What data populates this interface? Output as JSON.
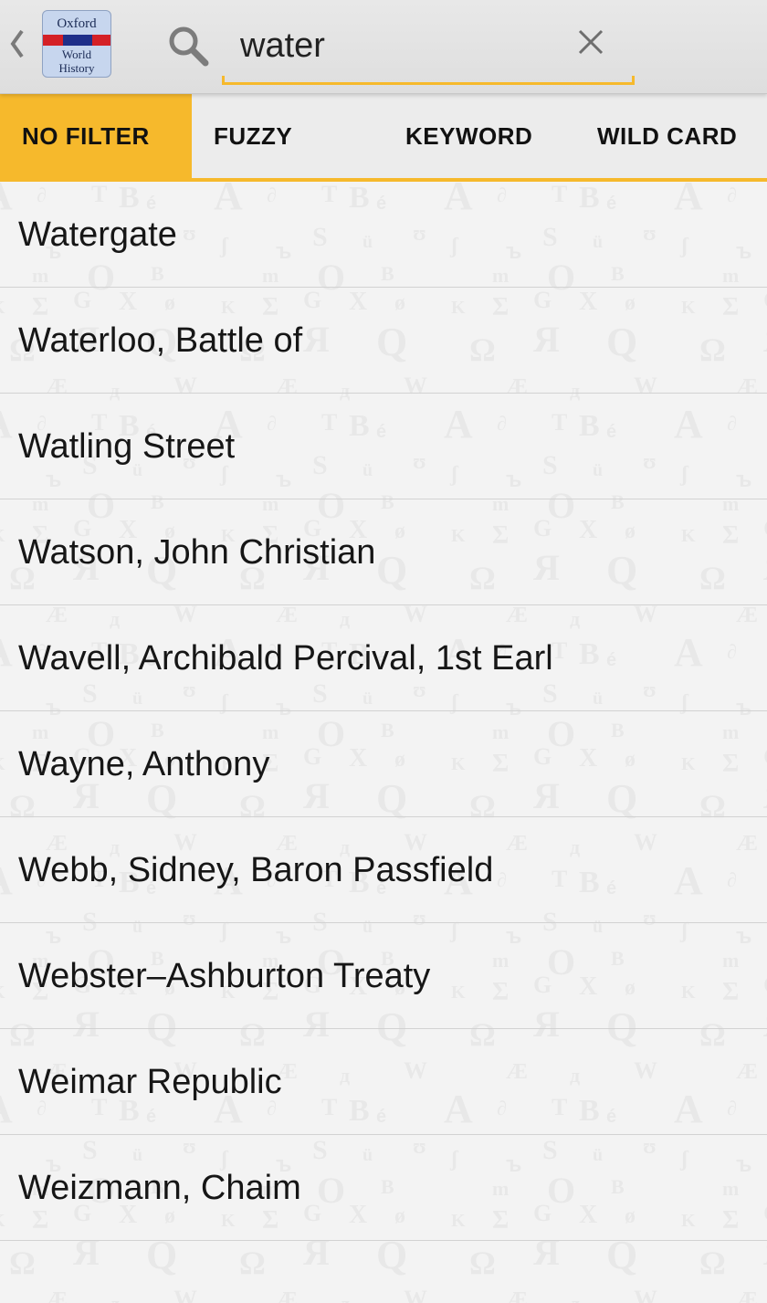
{
  "app": {
    "logo_lines": [
      "Oxford",
      "World",
      "History"
    ]
  },
  "search": {
    "value": "water",
    "placeholder": ""
  },
  "icons": {
    "back": "chevron-left-icon",
    "search": "search-icon",
    "clear": "close-icon"
  },
  "colors": {
    "accent": "#f6b92c",
    "logo_red": "#d42027",
    "logo_blue": "#1f2f8a"
  },
  "filters": {
    "selected": "NO FILTER",
    "tabs": [
      {
        "label": "NO FILTER"
      },
      {
        "label": "FUZZY"
      },
      {
        "label": "KEYWORD"
      },
      {
        "label": "WILD CARD"
      }
    ]
  },
  "results": [
    {
      "label": "Watergate"
    },
    {
      "label": "Waterloo, Battle of"
    },
    {
      "label": "Watling Street"
    },
    {
      "label": "Watson, John Christian"
    },
    {
      "label": "Wavell, Archibald Percival, 1st Earl"
    },
    {
      "label": "Wayne, Anthony"
    },
    {
      "label": "Webb, Sidney, Baron Passfield"
    },
    {
      "label": "Webster–Ashburton Treaty"
    },
    {
      "label": "Weimar Republic"
    },
    {
      "label": "Weizmann, Chaim"
    }
  ]
}
